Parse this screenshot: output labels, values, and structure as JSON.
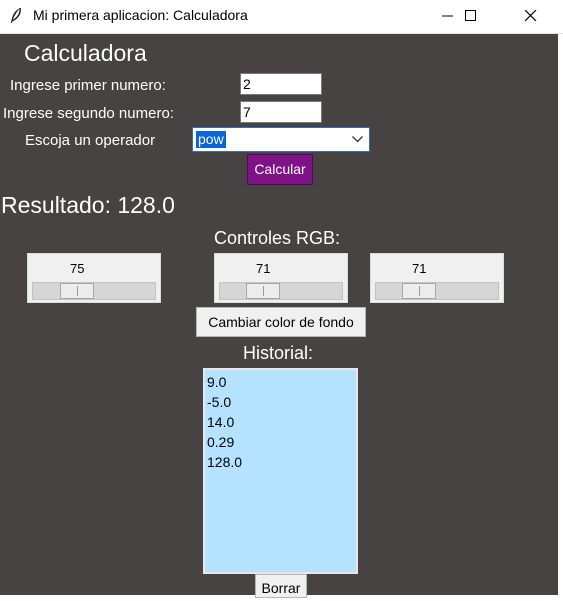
{
  "window": {
    "title": "Mi primera aplicacion: Calculadora",
    "app_icon": "feather-icon"
  },
  "app": {
    "title": "Calculadora",
    "label_first": "Ingrese primer numero:",
    "label_second": "Ingrese segundo numero:",
    "label_operator": "Escoja un operador",
    "first_value": "2",
    "second_value": "7",
    "operator_value": "pow",
    "calc_button": "Calcular",
    "result_text": "Resultado: 128.0",
    "rgb_title": "Controles RGB:",
    "sliders": [
      {
        "label": "75",
        "value": 75
      },
      {
        "label": "71",
        "value": 71
      },
      {
        "label": "71",
        "value": 71
      }
    ],
    "bg_button": "Cambiar color de fondo",
    "history_title": "Historial:",
    "history": [
      "9.0",
      "-5.0",
      "14.0",
      "0.29",
      "128.0"
    ],
    "clear_button": "Borrar"
  },
  "colors": {
    "background": "#464342",
    "calc_button": "#7d1386",
    "listbox": "#b5e3ff",
    "selection": "#0a64d6"
  }
}
